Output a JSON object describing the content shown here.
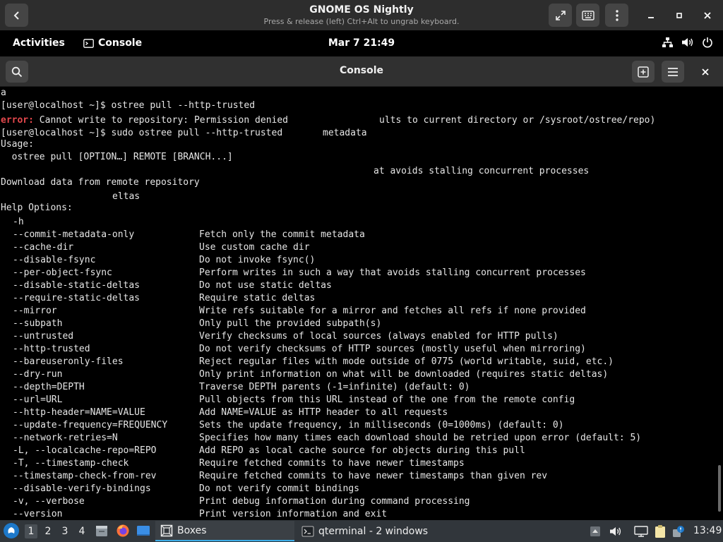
{
  "vm": {
    "title": "GNOME OS Nightly",
    "subtitle": "Press & release (left) Ctrl+Alt to ungrab keyboard."
  },
  "topbar": {
    "activities": "Activities",
    "app_name": "Console",
    "clock": "Mar 7  21:49"
  },
  "console": {
    "title": "Console"
  },
  "terminal": {
    "lines": [
      "a",
      "[user@localhost ~]$ ostree pull --http-trusted",
      "Cannot write to repository: Permission denied",
      "[user@localhost ~]$ sudo ostree pull --http-trusted",
      "Usage:",
      "  ostree pull [OPTION…] REMOTE [BRANCH...]",
      "",
      "Download data from remote repository",
      "",
      "Help Options:"
    ],
    "error_label": "error:",
    "fragments": {
      "line2_tail": "ults to current directory or /sysroot/ostree/repo)",
      "line3_tail": "metadata",
      "line5_tail": "at avoids stalling concurrent processes",
      "line7_tail": "eltas"
    },
    "options": [
      {
        "opt": "-h",
        "desc": ""
      },
      {
        "opt": "--commit-metadata-only",
        "desc": "Fetch only the commit metadata"
      },
      {
        "opt": "--cache-dir",
        "desc": "Use custom cache dir"
      },
      {
        "opt": "--disable-fsync",
        "desc": "Do not invoke fsync()"
      },
      {
        "opt": "--per-object-fsync",
        "desc": "Perform writes in such a way that avoids stalling concurrent processes"
      },
      {
        "opt": "--disable-static-deltas",
        "desc": "Do not use static deltas"
      },
      {
        "opt": "--require-static-deltas",
        "desc": "Require static deltas"
      },
      {
        "opt": "--mirror",
        "desc": "Write refs suitable for a mirror and fetches all refs if none provided"
      },
      {
        "opt": "--subpath",
        "desc": "Only pull the provided subpath(s)"
      },
      {
        "opt": "--untrusted",
        "desc": "Verify checksums of local sources (always enabled for HTTP pulls)"
      },
      {
        "opt": "--http-trusted",
        "desc": "Do not verify checksums of HTTP sources (mostly useful when mirroring)"
      },
      {
        "opt": "--bareuseronly-files",
        "desc": "Reject regular files with mode outside of 0775 (world writable, suid, etc.)"
      },
      {
        "opt": "--dry-run",
        "desc": "Only print information on what will be downloaded (requires static deltas)"
      },
      {
        "opt": "--depth=DEPTH",
        "desc": "Traverse DEPTH parents (-1=infinite) (default: 0)"
      },
      {
        "opt": "--url=URL",
        "desc": "Pull objects from this URL instead of the one from the remote config"
      },
      {
        "opt": "--http-header=NAME=VALUE",
        "desc": "Add NAME=VALUE as HTTP header to all requests"
      },
      {
        "opt": "--update-frequency=FREQUENCY",
        "desc": "Sets the update frequency, in milliseconds (0=1000ms) (default: 0)"
      },
      {
        "opt": "--network-retries=N",
        "desc": "Specifies how many times each download should be retried upon error (default: 5)"
      },
      {
        "opt": "-L, --localcache-repo=REPO",
        "desc": "Add REPO as local cache source for objects during this pull"
      },
      {
        "opt": "-T, --timestamp-check",
        "desc": "Require fetched commits to have newer timestamps"
      },
      {
        "opt": "--timestamp-check-from-rev",
        "desc": "Require fetched commits to have newer timestamps than given rev"
      },
      {
        "opt": "--disable-verify-bindings",
        "desc": "Do not verify commit bindings"
      },
      {
        "opt": "-v, --verbose",
        "desc": "Print debug information during command processing"
      },
      {
        "opt": "--version",
        "desc": "Print version information and exit"
      }
    ]
  },
  "panel": {
    "workspaces": [
      "1",
      "2",
      "3",
      "4"
    ],
    "active_workspace": "1",
    "tasks": [
      {
        "label": "Boxes",
        "active": true
      },
      {
        "label": "qterminal - 2 windows",
        "active": false
      }
    ],
    "clock": "13:49"
  },
  "colors": {
    "error_red": "#e5484d",
    "panel_bg": "#31363b",
    "accent_blue": "#3daee9"
  }
}
